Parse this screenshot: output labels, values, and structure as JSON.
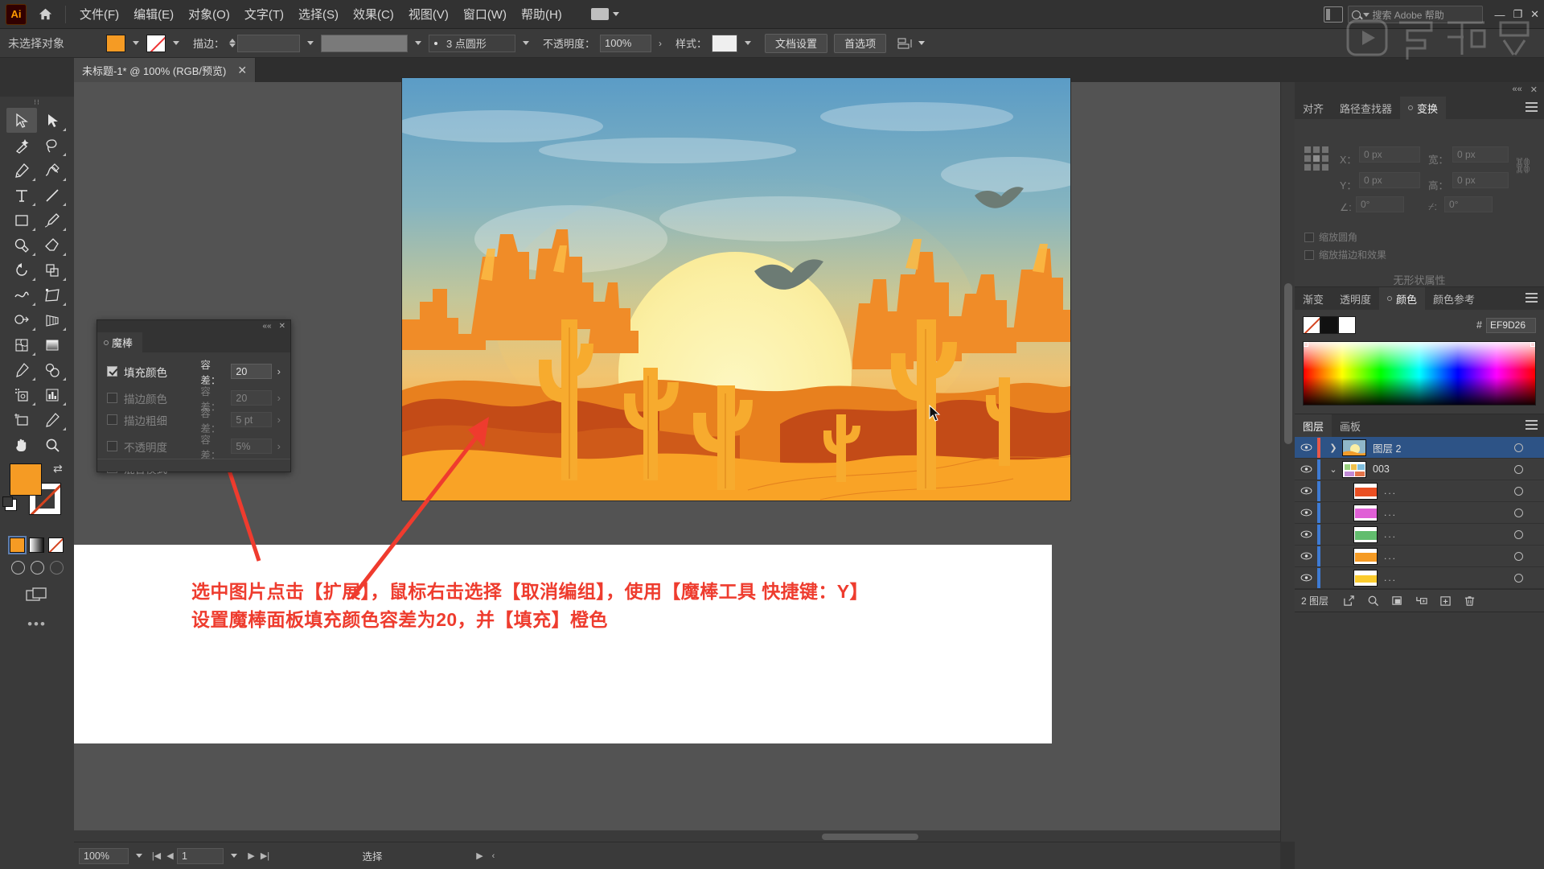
{
  "app": {
    "logo": "Ai",
    "home_icon": "home-icon"
  },
  "menu": {
    "items": [
      {
        "label": "文件(F)"
      },
      {
        "label": "编辑(E)"
      },
      {
        "label": "对象(O)"
      },
      {
        "label": "文字(T)"
      },
      {
        "label": "选择(S)"
      },
      {
        "label": "效果(C)"
      },
      {
        "label": "视图(V)"
      },
      {
        "label": "窗口(W)"
      },
      {
        "label": "帮助(H)"
      }
    ],
    "search_placeholder": "搜索 Adobe 帮助",
    "window_minimize": "—",
    "window_restore": "❐",
    "window_close": "✕"
  },
  "options": {
    "selection_label": "未选择对象",
    "fill_color": "#f59b24",
    "stroke_label": "描边：",
    "stroke_weight": "",
    "brush_label": "3 点圆形",
    "opacity_label": "不透明度：",
    "opacity_value": "100%",
    "style_label": "样式：",
    "doc_setup_button": "文档设置",
    "preferences_button": "首选项",
    "align_icon": "align-icon"
  },
  "document": {
    "tab_title": "未标题-1* @ 100% (RGB/预览)",
    "close_icon": "✕"
  },
  "toolbar": {
    "tools": [
      {
        "name": "selection-tool",
        "active": true
      },
      {
        "name": "direct-selection-tool",
        "active": false
      },
      {
        "name": "magic-wand-tool",
        "active": false
      },
      {
        "name": "lasso-tool",
        "active": false
      },
      {
        "name": "pen-tool",
        "active": false
      },
      {
        "name": "curvature-tool",
        "active": false
      },
      {
        "name": "type-tool",
        "active": false
      },
      {
        "name": "line-segment-tool",
        "active": false
      },
      {
        "name": "rectangle-tool",
        "active": false
      },
      {
        "name": "paintbrush-tool",
        "active": false
      },
      {
        "name": "shaper-tool",
        "active": false
      },
      {
        "name": "eraser-tool",
        "active": false
      },
      {
        "name": "rotate-tool",
        "active": false
      },
      {
        "name": "scale-tool",
        "active": false
      },
      {
        "name": "width-tool",
        "active": false
      },
      {
        "name": "free-transform-tool",
        "active": false
      },
      {
        "name": "shape-builder-tool",
        "active": false
      },
      {
        "name": "perspective-grid-tool",
        "active": false
      },
      {
        "name": "mesh-tool",
        "active": false
      },
      {
        "name": "gradient-tool",
        "active": false
      },
      {
        "name": "eyedropper-tool",
        "active": false
      },
      {
        "name": "blend-tool",
        "active": false
      },
      {
        "name": "symbol-sprayer-tool",
        "active": false
      },
      {
        "name": "column-graph-tool",
        "active": false
      },
      {
        "name": "artboard-tool",
        "active": false
      },
      {
        "name": "slice-tool",
        "active": false
      },
      {
        "name": "hand-tool",
        "active": false
      },
      {
        "name": "zoom-tool",
        "active": false
      }
    ],
    "fill_swatch": "#f59b24",
    "stroke_swatch": "none",
    "more_tools": "•••"
  },
  "magic_wand_panel": {
    "title": "魔棒",
    "collapse_icon": "««",
    "close_icon": "✕",
    "rows": [
      {
        "label": "填充颜色",
        "checked": true,
        "tol_label": "容差：",
        "tol_value": "20",
        "enabled": true
      },
      {
        "label": "描边颜色",
        "checked": false,
        "tol_label": "容差：",
        "tol_value": "20",
        "enabled": false
      },
      {
        "label": "描边粗细",
        "checked": false,
        "tol_label": "容差：",
        "tol_value": "5 pt",
        "enabled": false
      },
      {
        "label": "不透明度",
        "checked": false,
        "tol_label": "容差：",
        "tol_value": "5%",
        "enabled": false
      },
      {
        "label": "混合模式",
        "checked": false,
        "tol_label": "",
        "tol_value": "",
        "enabled": false
      }
    ]
  },
  "transform_panel": {
    "tabs": [
      {
        "label": "对齐",
        "active": false
      },
      {
        "label": "路径查找器",
        "active": false
      },
      {
        "label": "变换",
        "active": true
      }
    ],
    "x_label": "X：",
    "x_value": "0 px",
    "y_label": "Y：",
    "y_value": "0 px",
    "w_label": "宽：",
    "w_value": "0 px",
    "h_label": "高：",
    "h_value": "0 px",
    "angle_label": "∠:",
    "angle_value": "0°",
    "shear_label": "⌿:",
    "shear_value": "0°",
    "chk_scale_corners": "缩放圆角",
    "chk_scale_strokes": "缩放描边和效果",
    "no_attr_text": "无形状属性",
    "link_icon": "link-icon",
    "menu_icon": "panel-menu-icon"
  },
  "color_panel": {
    "tabs": [
      {
        "label": "渐变",
        "active": false
      },
      {
        "label": "透明度",
        "active": false
      },
      {
        "label": "颜色",
        "active": true
      },
      {
        "label": "颜色参考",
        "active": false
      }
    ],
    "hash": "#",
    "hex_value": "EF9D26",
    "swatches": [
      "none",
      "black",
      "white"
    ],
    "menu_icon": "panel-menu-icon"
  },
  "layers_panel": {
    "tabs": [
      {
        "label": "图层",
        "active": true
      },
      {
        "label": "画板",
        "active": false
      }
    ],
    "rows": [
      {
        "name": "图层 2",
        "selected": true,
        "indent": 0,
        "color": "#e8584a",
        "expand": "collapsed",
        "thumb": "artwork",
        "dots": ""
      },
      {
        "name": "003",
        "selected": false,
        "indent": 1,
        "color": "#3e7bd4",
        "expand": "expanded",
        "thumb": "group",
        "dots": ""
      },
      {
        "name": "",
        "selected": false,
        "indent": 2,
        "color": "#3e7bd4",
        "expand": "none",
        "thumb": "red",
        "dots": "..."
      },
      {
        "name": "",
        "selected": false,
        "indent": 2,
        "color": "#3e7bd4",
        "expand": "none",
        "thumb": "magenta",
        "dots": "..."
      },
      {
        "name": "",
        "selected": false,
        "indent": 2,
        "color": "#3e7bd4",
        "expand": "none",
        "thumb": "green",
        "dots": "..."
      },
      {
        "name": "",
        "selected": false,
        "indent": 2,
        "color": "#3e7bd4",
        "expand": "none",
        "thumb": "orange",
        "dots": "..."
      },
      {
        "name": "",
        "selected": false,
        "indent": 2,
        "color": "#3e7bd4",
        "expand": "none",
        "thumb": "yellow",
        "dots": "..."
      }
    ],
    "footer_count": "2 图层",
    "footer_icons": [
      "locate-object-icon",
      "search-icon",
      "make-clipping-mask-icon",
      "create-sublayer-icon",
      "new-layer-icon",
      "delete-layer-icon"
    ]
  },
  "annotation": {
    "line1": "选中图片点击【扩展】，鼠标右击选择【取消编组】，使用【魔棒工具 快捷键：Y】",
    "line2": "设置魔棒面板填充颜色容差为20，并【填充】橙色"
  },
  "statusbar": {
    "zoom": "100%",
    "page": "1",
    "status_text": "选择",
    "first_icon": "|◀",
    "prev_icon": "◀",
    "next_icon": "▶",
    "last_icon": "▶|"
  },
  "artwork": {
    "name": "desert-sunset-illustration",
    "sky_top": "#5a9ac4",
    "sky_mid": "#97c0bd",
    "sky_glow": "#f0c878",
    "sun": "#fbf0a6",
    "dune_front": "#f9a326",
    "dune_mid": "#e8801e",
    "mesa_dark": "#c34b17",
    "cactus": "#f5a92e",
    "bird": "#6b7a74"
  }
}
